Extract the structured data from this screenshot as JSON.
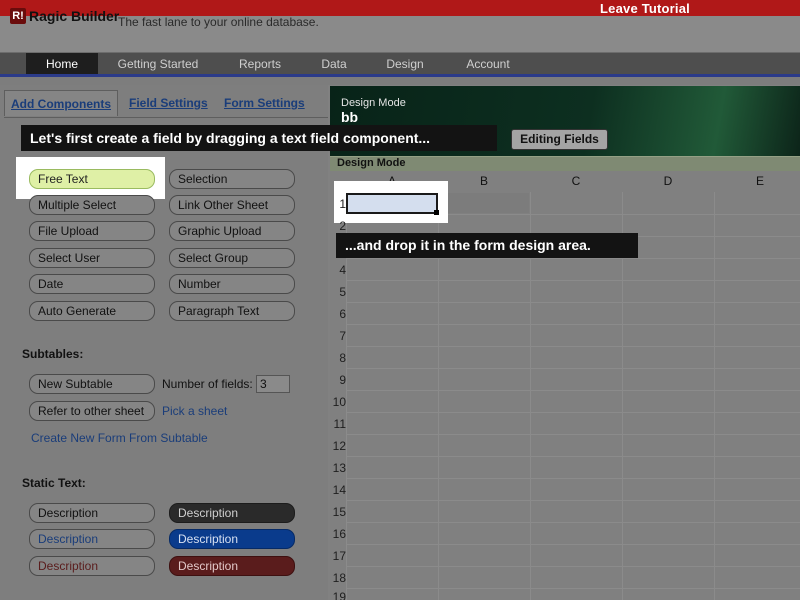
{
  "tutorial": {
    "leave_label": "Leave Tutorial"
  },
  "header": {
    "logo_mark": "R!",
    "logo_text": "Ragic Builder",
    "tagline": "The fast lane to your online database."
  },
  "nav": {
    "items": [
      {
        "label": "Home",
        "active": true
      },
      {
        "label": "Getting Started"
      },
      {
        "label": "Reports"
      },
      {
        "label": "Data"
      },
      {
        "label": "Design"
      },
      {
        "label": "Account"
      }
    ]
  },
  "tabs": {
    "add_components": "Add Components",
    "field_settings": "Field Settings",
    "form_settings": "Form Settings"
  },
  "tooltips": {
    "step1": "Let's first create a field by dragging a text field component...",
    "step2": "...and drop it in the form design area."
  },
  "components": {
    "free_text": "Free Text",
    "selection": "Selection",
    "multiple_select": "Multiple Select",
    "link_other_sheet": "Link Other Sheet",
    "file_upload": "File Upload",
    "graphic_upload": "Graphic Upload",
    "select_user": "Select User",
    "select_group": "Select Group",
    "date": "Date",
    "number": "Number",
    "auto_generate": "Auto Generate",
    "paragraph_text": "Paragraph Text"
  },
  "subtables": {
    "label": "Subtables:",
    "new_subtable": "New Subtable",
    "number_of_fields_label": "Number of fields:",
    "number_of_fields_value": "3",
    "refer_to_other_sheet": "Refer to other sheet",
    "pick_a_sheet": "Pick a sheet",
    "create_new_form": "Create New Form From Subtable"
  },
  "static_text": {
    "label": "Static Text:",
    "items": [
      "Description",
      "Description",
      "Description",
      "Description",
      "Description",
      "Description"
    ]
  },
  "design": {
    "mode_label": "Design Mode",
    "sheet_name": "bb",
    "editing_fields": "Editing Fields",
    "strip_label": "Design Mode"
  },
  "grid": {
    "columns": [
      "A",
      "B",
      "C",
      "D",
      "E"
    ],
    "rows": [
      "1",
      "2",
      "3",
      "4",
      "5",
      "6",
      "7",
      "8",
      "9",
      "10",
      "11",
      "12",
      "13",
      "14",
      "15",
      "16",
      "17",
      "18",
      "19"
    ]
  },
  "colors": {
    "tutorial_bar": "#b01818",
    "nav_accent": "#2b3b8a",
    "free_text_highlight": "#dff0a6",
    "blue_description": "#0a3b8c",
    "maroon_description": "#5a1c1c"
  }
}
